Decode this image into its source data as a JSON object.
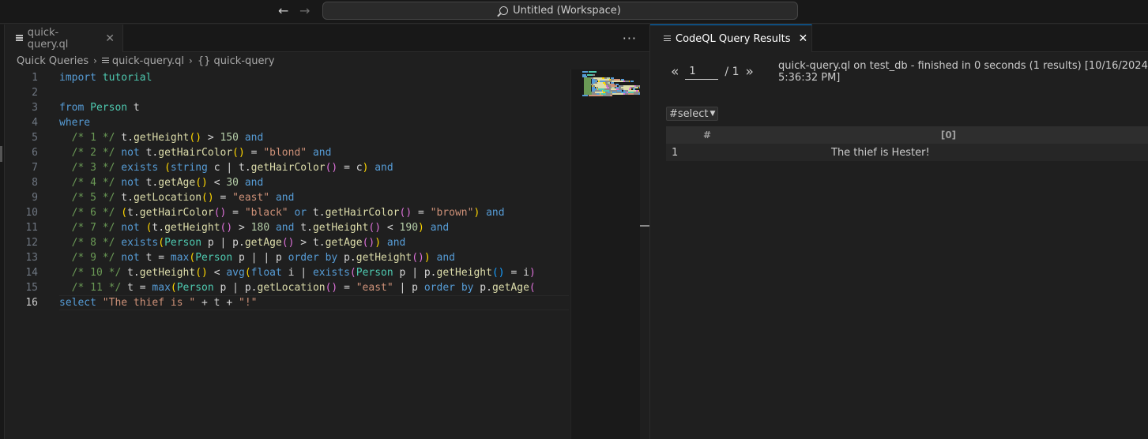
{
  "titlebar": {
    "back_icon": "arrow-left-icon",
    "forward_icon": "arrow-right-icon",
    "search_label": "Untitled (Workspace)"
  },
  "editor": {
    "tab_label": "quick-query.ql",
    "more_label": "···",
    "breadcrumb": [
      "Quick Queries",
      "quick-query.ql",
      "{} quick-query"
    ],
    "lines": [
      {
        "n": "1",
        "tokens": [
          [
            "kw",
            "import"
          ],
          [
            "pl",
            " "
          ],
          [
            "ty",
            "tutorial"
          ]
        ]
      },
      {
        "n": "2",
        "tokens": []
      },
      {
        "n": "3",
        "tokens": [
          [
            "kw",
            "from"
          ],
          [
            "pl",
            " "
          ],
          [
            "ty",
            "Person"
          ],
          [
            "pl",
            " t"
          ]
        ]
      },
      {
        "n": "4",
        "tokens": [
          [
            "kw",
            "where"
          ]
        ]
      },
      {
        "n": "5",
        "tokens": [
          [
            "pl",
            "  "
          ],
          [
            "cm",
            "/* 1 */"
          ],
          [
            "pl",
            " t."
          ],
          [
            "fn",
            "getHeight"
          ],
          [
            "br1",
            "()"
          ],
          [
            "pl",
            " > "
          ],
          [
            "nu",
            "150"
          ],
          [
            "pl",
            " "
          ],
          [
            "kw",
            "and"
          ]
        ]
      },
      {
        "n": "6",
        "tokens": [
          [
            "pl",
            "  "
          ],
          [
            "cm",
            "/* 2 */"
          ],
          [
            "pl",
            " "
          ],
          [
            "kw",
            "not"
          ],
          [
            "pl",
            " t."
          ],
          [
            "fn",
            "getHairColor"
          ],
          [
            "br1",
            "()"
          ],
          [
            "pl",
            " = "
          ],
          [
            "st",
            "\"blond\""
          ],
          [
            "pl",
            " "
          ],
          [
            "kw",
            "and"
          ]
        ]
      },
      {
        "n": "7",
        "tokens": [
          [
            "pl",
            "  "
          ],
          [
            "cm",
            "/* 3 */"
          ],
          [
            "pl",
            " "
          ],
          [
            "kw",
            "exists"
          ],
          [
            "pl",
            " "
          ],
          [
            "br1",
            "("
          ],
          [
            "kw",
            "string"
          ],
          [
            "pl",
            " c | t."
          ],
          [
            "fn",
            "getHairColor"
          ],
          [
            "br2",
            "()"
          ],
          [
            "pl",
            " = c"
          ],
          [
            "br1",
            ")"
          ],
          [
            "pl",
            " "
          ],
          [
            "kw",
            "and"
          ]
        ]
      },
      {
        "n": "8",
        "tokens": [
          [
            "pl",
            "  "
          ],
          [
            "cm",
            "/* 4 */"
          ],
          [
            "pl",
            " "
          ],
          [
            "kw",
            "not"
          ],
          [
            "pl",
            " t."
          ],
          [
            "fn",
            "getAge"
          ],
          [
            "br1",
            "()"
          ],
          [
            "pl",
            " < "
          ],
          [
            "nu",
            "30"
          ],
          [
            "pl",
            " "
          ],
          [
            "kw",
            "and"
          ]
        ]
      },
      {
        "n": "9",
        "tokens": [
          [
            "pl",
            "  "
          ],
          [
            "cm",
            "/* 5 */"
          ],
          [
            "pl",
            " t."
          ],
          [
            "fn",
            "getLocation"
          ],
          [
            "br1",
            "()"
          ],
          [
            "pl",
            " = "
          ],
          [
            "st",
            "\"east\""
          ],
          [
            "pl",
            " "
          ],
          [
            "kw",
            "and"
          ]
        ]
      },
      {
        "n": "10",
        "tokens": [
          [
            "pl",
            "  "
          ],
          [
            "cm",
            "/* 6 */"
          ],
          [
            "pl",
            " "
          ],
          [
            "br1",
            "("
          ],
          [
            "pl",
            "t."
          ],
          [
            "fn",
            "getHairColor"
          ],
          [
            "br2",
            "()"
          ],
          [
            "pl",
            " = "
          ],
          [
            "st",
            "\"black\""
          ],
          [
            "pl",
            " "
          ],
          [
            "kw",
            "or"
          ],
          [
            "pl",
            " t."
          ],
          [
            "fn",
            "getHairColor"
          ],
          [
            "br2",
            "()"
          ],
          [
            "pl",
            " = "
          ],
          [
            "st",
            "\"brown\""
          ],
          [
            "br1",
            ")"
          ],
          [
            "pl",
            " "
          ],
          [
            "kw",
            "and"
          ]
        ]
      },
      {
        "n": "11",
        "tokens": [
          [
            "pl",
            "  "
          ],
          [
            "cm",
            "/* 7 */"
          ],
          [
            "pl",
            " "
          ],
          [
            "kw",
            "not"
          ],
          [
            "pl",
            " "
          ],
          [
            "br1",
            "("
          ],
          [
            "pl",
            "t."
          ],
          [
            "fn",
            "getHeight"
          ],
          [
            "br2",
            "()"
          ],
          [
            "pl",
            " > "
          ],
          [
            "nu",
            "180"
          ],
          [
            "pl",
            " "
          ],
          [
            "kw",
            "and"
          ],
          [
            "pl",
            " t."
          ],
          [
            "fn",
            "getHeight"
          ],
          [
            "br2",
            "()"
          ],
          [
            "pl",
            " < "
          ],
          [
            "nu",
            "190"
          ],
          [
            "br1",
            ")"
          ],
          [
            "pl",
            " "
          ],
          [
            "kw",
            "and"
          ]
        ]
      },
      {
        "n": "12",
        "tokens": [
          [
            "pl",
            "  "
          ],
          [
            "cm",
            "/* 8 */"
          ],
          [
            "pl",
            " "
          ],
          [
            "kw",
            "exists"
          ],
          [
            "br1",
            "("
          ],
          [
            "ty",
            "Person"
          ],
          [
            "pl",
            " p | p."
          ],
          [
            "fn",
            "getAge"
          ],
          [
            "br2",
            "()"
          ],
          [
            "pl",
            " > t."
          ],
          [
            "fn",
            "getAge"
          ],
          [
            "br2",
            "()"
          ],
          [
            "br1",
            ")"
          ],
          [
            "pl",
            " "
          ],
          [
            "kw",
            "and"
          ]
        ]
      },
      {
        "n": "13",
        "tokens": [
          [
            "pl",
            "  "
          ],
          [
            "cm",
            "/* 9 */"
          ],
          [
            "pl",
            " "
          ],
          [
            "kw",
            "not"
          ],
          [
            "pl",
            " t = "
          ],
          [
            "kw",
            "max"
          ],
          [
            "br1",
            "("
          ],
          [
            "ty",
            "Person"
          ],
          [
            "pl",
            " p | | p "
          ],
          [
            "kw",
            "order"
          ],
          [
            "pl",
            " "
          ],
          [
            "kw",
            "by"
          ],
          [
            "pl",
            " p."
          ],
          [
            "fn",
            "getHeight"
          ],
          [
            "br2",
            "()"
          ],
          [
            "br1",
            ")"
          ],
          [
            "pl",
            " "
          ],
          [
            "kw",
            "and"
          ]
        ]
      },
      {
        "n": "14",
        "tokens": [
          [
            "pl",
            "  "
          ],
          [
            "cm",
            "/* 10 */"
          ],
          [
            "pl",
            " t."
          ],
          [
            "fn",
            "getHeight"
          ],
          [
            "br1",
            "()"
          ],
          [
            "pl",
            " < "
          ],
          [
            "kw",
            "avg"
          ],
          [
            "br1",
            "("
          ],
          [
            "kw",
            "float"
          ],
          [
            "pl",
            " i | "
          ],
          [
            "kw",
            "exists"
          ],
          [
            "br2",
            "("
          ],
          [
            "ty",
            "Person"
          ],
          [
            "pl",
            " p | p."
          ],
          [
            "fn",
            "getHeight"
          ],
          [
            "br3",
            "()"
          ],
          [
            "pl",
            " = i"
          ],
          [
            "br2",
            ")"
          ]
        ]
      },
      {
        "n": "15",
        "tokens": [
          [
            "pl",
            "  "
          ],
          [
            "cm",
            "/* 11 */"
          ],
          [
            "pl",
            " t = "
          ],
          [
            "kw",
            "max"
          ],
          [
            "br1",
            "("
          ],
          [
            "ty",
            "Person"
          ],
          [
            "pl",
            " p | p."
          ],
          [
            "fn",
            "getLocation"
          ],
          [
            "br2",
            "()"
          ],
          [
            "pl",
            " = "
          ],
          [
            "st",
            "\"east\""
          ],
          [
            "pl",
            " | p "
          ],
          [
            "kw",
            "order"
          ],
          [
            "pl",
            " "
          ],
          [
            "kw",
            "by"
          ],
          [
            "pl",
            " p."
          ],
          [
            "fn",
            "getAge"
          ],
          [
            "br2",
            "("
          ]
        ]
      },
      {
        "n": "16",
        "tokens": [
          [
            "kw",
            "select"
          ],
          [
            "pl",
            " "
          ],
          [
            "st",
            "\"The thief is \""
          ],
          [
            "pl",
            " + t + "
          ],
          [
            "st",
            "\"!\""
          ]
        ]
      }
    ]
  },
  "results": {
    "tab_label": "CodeQL Query Results",
    "prev_label": "«",
    "next_label": "»",
    "page_value": "1",
    "page_total": "/ 1",
    "info": "quick-query.ql on test_db - finished in 0 seconds (1 results) [10/16/2024 5:36:32 PM]",
    "select_value": "#select",
    "columns": [
      "#",
      "[0]"
    ],
    "rows": [
      [
        "1",
        "The thief is Hester!"
      ]
    ]
  },
  "colors": {
    "accent": "#0078d4",
    "keyword": "#569cd6",
    "type": "#4ec9b0",
    "function": "#dcdcaa",
    "string": "#ce9178",
    "number": "#b5cea8",
    "comment": "#6a9955"
  }
}
